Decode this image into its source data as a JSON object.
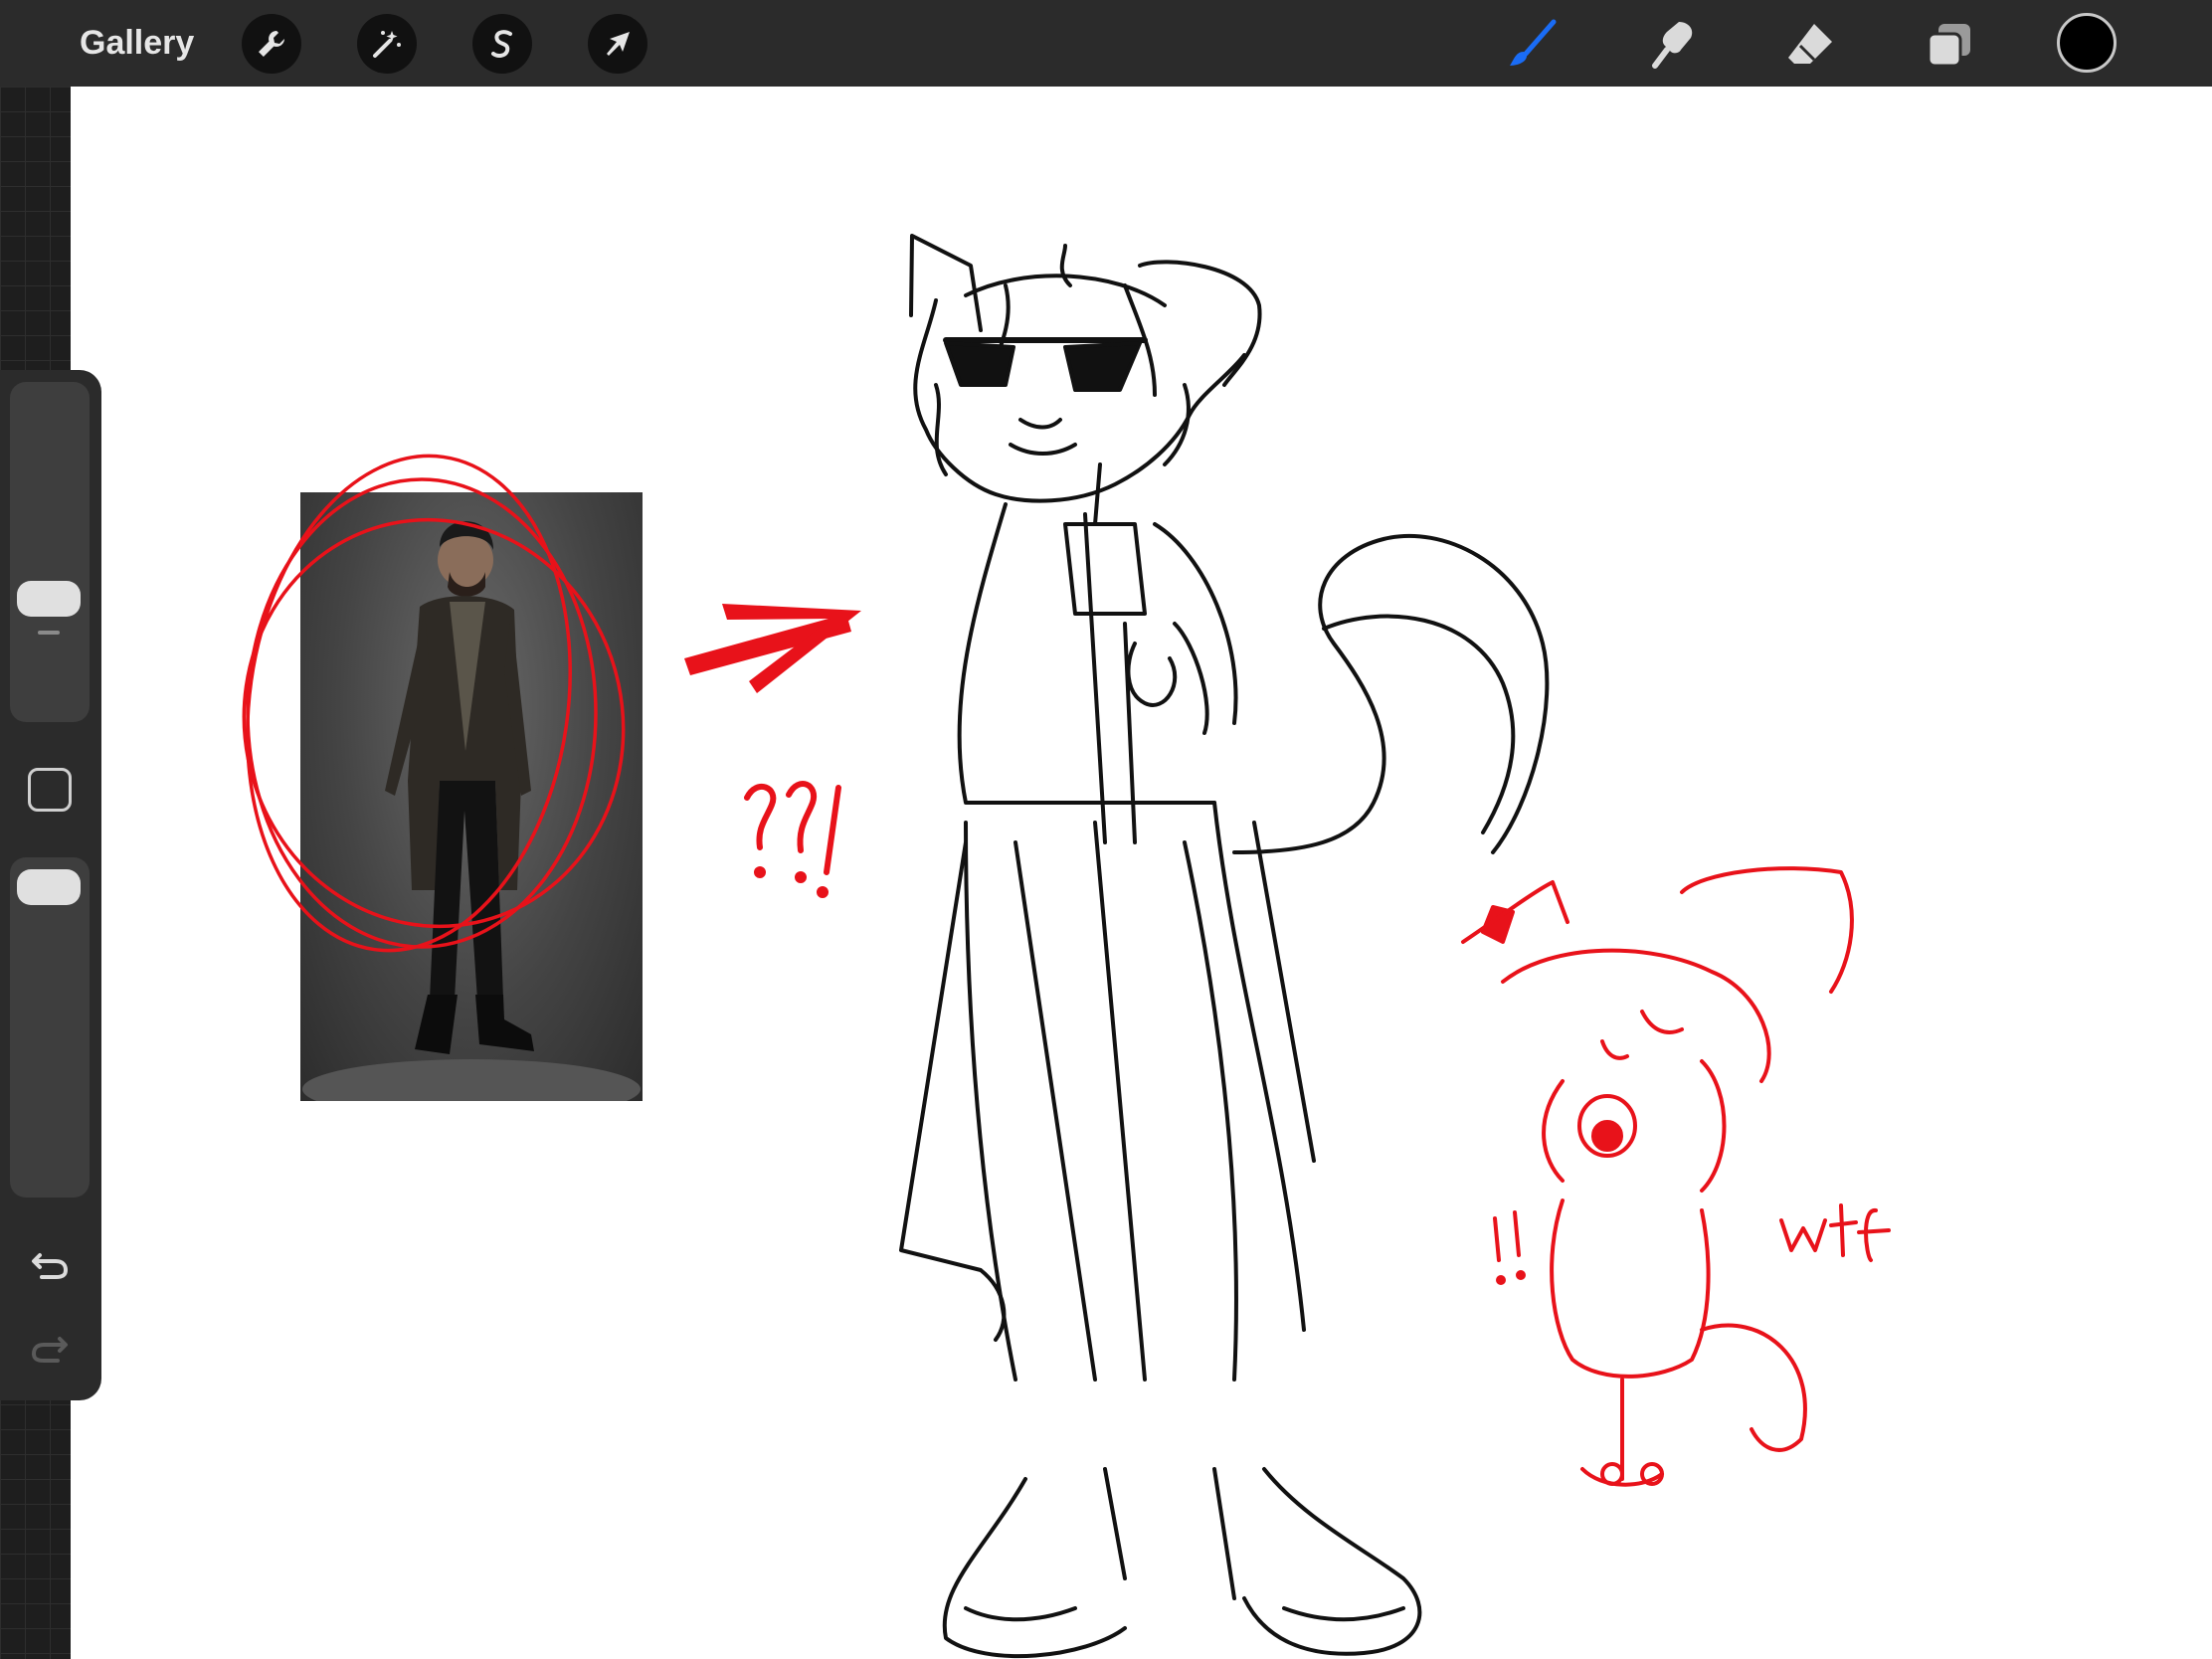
{
  "app": {
    "gallery_label": "Gallery"
  },
  "toolbar": {
    "left_tools": [
      {
        "name": "actions",
        "icon": "wrench-icon"
      },
      {
        "name": "adjustments",
        "icon": "magic-wand-icon"
      },
      {
        "name": "selection",
        "icon": "selection-s-icon"
      },
      {
        "name": "transform",
        "icon": "arrow-cursor-icon"
      }
    ],
    "right_tools": [
      {
        "name": "brush",
        "icon": "brush-icon",
        "active": true
      },
      {
        "name": "smudge",
        "icon": "smudge-icon",
        "active": false
      },
      {
        "name": "eraser",
        "icon": "eraser-icon",
        "active": false
      },
      {
        "name": "layers",
        "icon": "layers-icon",
        "active": false
      }
    ],
    "current_color": "#000000",
    "active_color": "#1a6cf5"
  },
  "sidebar": {
    "brush_size_icon": "slider-handle",
    "opacity_icon": "slider-handle",
    "modify_icon": "square-icon",
    "undo_icon": "undo-icon",
    "redo_icon": "redo-icon"
  },
  "canvas": {
    "sketch_color": "#000000",
    "annotation_color": "#e8121a",
    "annotations": {
      "question_marks": "??!",
      "exclaim": "!!",
      "reaction": "wtf"
    }
  }
}
